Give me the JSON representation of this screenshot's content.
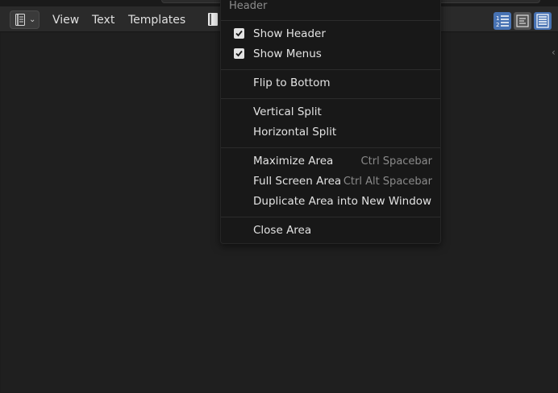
{
  "header": {
    "menus": [
      "View",
      "Text",
      "Templates"
    ]
  },
  "popup": {
    "title": "Header",
    "items": [
      {
        "label": "Show Header",
        "checked": true
      },
      {
        "label": "Show Menus",
        "checked": true
      },
      {
        "label": "Flip to Bottom"
      },
      {
        "label": "Vertical Split"
      },
      {
        "label": "Horizontal Split"
      },
      {
        "label": "Maximize Area",
        "shortcut": "Ctrl Spacebar"
      },
      {
        "label": "Full Screen Area",
        "shortcut": "Ctrl Alt Spacebar"
      },
      {
        "label": "Duplicate Area into New Window"
      },
      {
        "label": "Close Area"
      }
    ]
  },
  "colors": {
    "accent": "#4772b3",
    "background": "#1f1f1f",
    "menu_bg": "#181818"
  }
}
